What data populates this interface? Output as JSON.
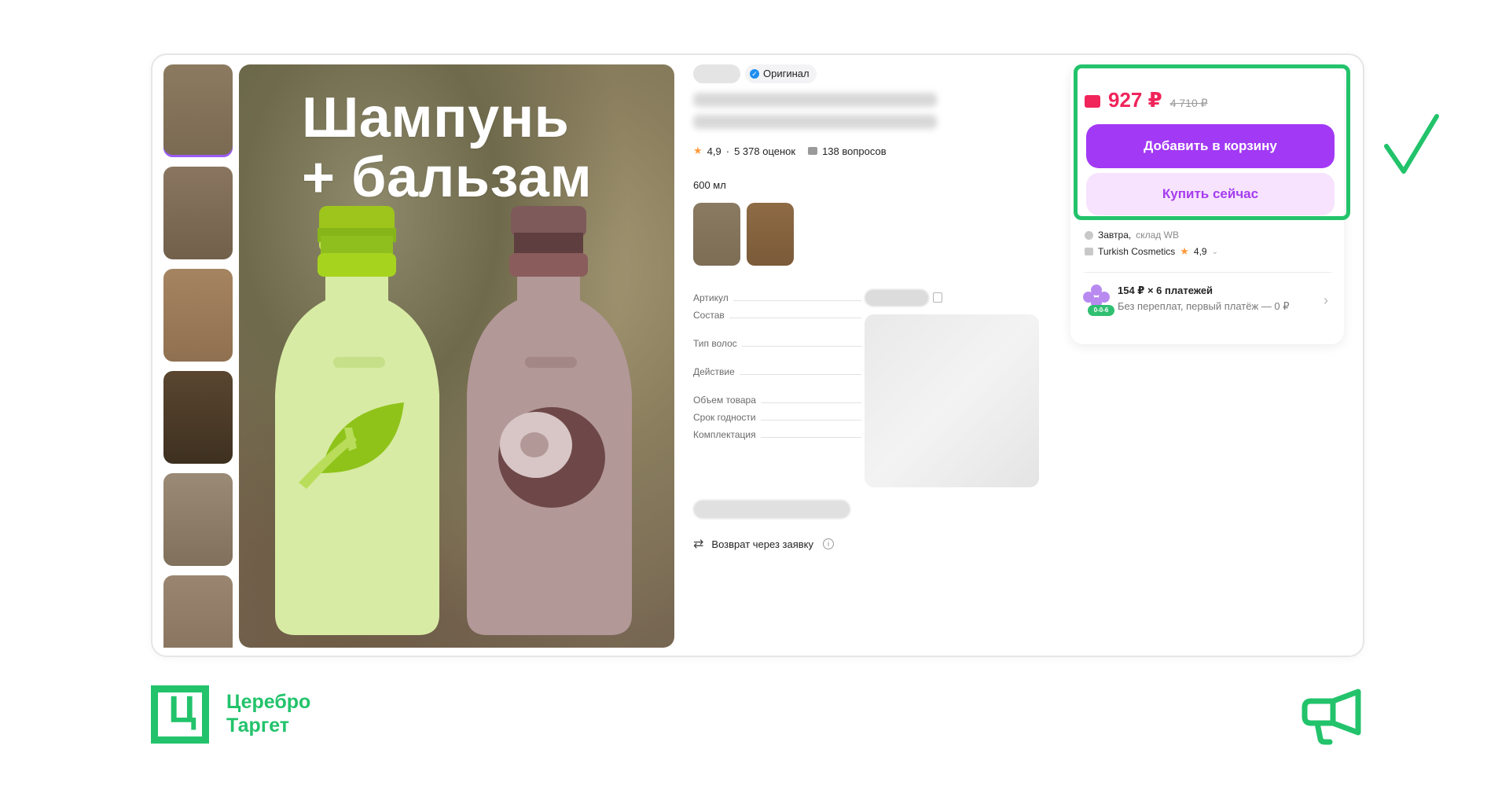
{
  "product_image": {
    "headline_line1": "Шампунь",
    "headline_line2": "+ бальзам"
  },
  "product_info": {
    "badge_label": "Оригинал",
    "rating_value": "4,9",
    "reviews_count": "5 378 оценок",
    "questions_count": "138 вопросов",
    "volume_label": "600 мл",
    "specs": [
      {
        "label": "Артикул"
      },
      {
        "label": "Состав"
      },
      {
        "label": "Тип волос"
      },
      {
        "label": "Действие"
      },
      {
        "label": "Объем товара"
      },
      {
        "label": "Срок годности"
      },
      {
        "label": "Комплектация"
      }
    ],
    "return_text": "Возврат через заявку"
  },
  "buy_panel": {
    "price": "927 ₽",
    "old_price": "4 710 ₽",
    "add_to_cart_label": "Добавить в корзину",
    "buy_now_label": "Купить сейчас",
    "delivery_day": "Завтра,",
    "delivery_warehouse": "склад WB",
    "seller_name": "Turkish Cosmetics",
    "seller_rating": "4,9",
    "installment_title": "154 ₽ × 6 платежей",
    "installment_subtitle": "Без переплат, первый платёж — 0 ₽",
    "installment_badge": "0-0-6"
  },
  "footer": {
    "logo_glyph": "Ц",
    "brand_line1": "Церебро",
    "brand_line2": "Таргет"
  },
  "colors": {
    "accent_green": "#22c36b",
    "cart_button": "#a239f5",
    "price_red": "#f0255a"
  },
  "icons": {
    "checkmark": "checkmark-icon",
    "megaphone": "megaphone-icon"
  }
}
